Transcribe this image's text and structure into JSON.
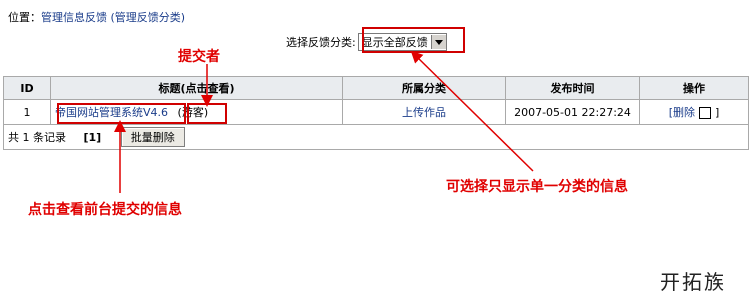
{
  "breadcrumb": {
    "prefix": "位置：",
    "link": "管理信息反馈 (管理反馈分类)"
  },
  "filter": {
    "label": "选择反馈分类:",
    "selected": "显示全部反馈"
  },
  "table": {
    "headers": [
      "ID",
      "标题(点击查看)",
      "所属分类",
      "发布时间",
      "操作"
    ],
    "rows": [
      {
        "id": "1",
        "title": "帝国网站管理系统V4.6",
        "submitter": "(游客)",
        "category": "上传作品",
        "time": "2007-05-01 22:27:24",
        "action": "[删除",
        "action_end": "]"
      }
    ],
    "footer": {
      "count_text": "共 1 条记录",
      "pages": "[1]",
      "bulk_delete": "批量删除"
    }
  },
  "annotations": {
    "submitter": "提交者",
    "click_view": "点击查看前台提交的信息",
    "filter_tip": "可选择只显示单一分类的信息"
  },
  "watermark": "开拓族",
  "colors": {
    "annotation": "#e00000",
    "link": "#1a3c8a",
    "header_bg": "#e9ecef"
  }
}
